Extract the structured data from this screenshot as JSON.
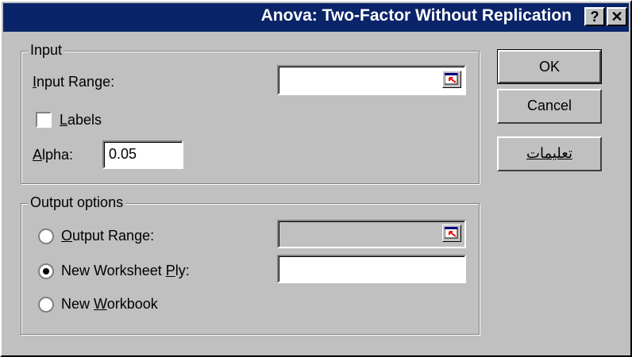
{
  "window": {
    "title": "Anova: Two-Factor Without Replication",
    "help_glyph": "?",
    "close_glyph": "✕"
  },
  "input_group": {
    "legend": "Input",
    "input_range_label_accel": "I",
    "input_range_label_rest": "nput Range:",
    "input_range_value": "",
    "labels_label_accel": "L",
    "labels_label_rest": "abels",
    "labels_checked": false,
    "alpha_label_accel": "A",
    "alpha_label_rest": "lpha:",
    "alpha_value": "0.05"
  },
  "output_group": {
    "legend": "Output options",
    "output_range_label_accel": "O",
    "output_range_label_rest": "utput Range:",
    "output_range_value": "",
    "new_worksheet_label_pre": "New Worksheet ",
    "new_worksheet_label_accel": "P",
    "new_worksheet_label_post": "ly:",
    "new_worksheet_value": "",
    "new_workbook_label_pre": "New ",
    "new_workbook_label_accel": "W",
    "new_workbook_label_post": "orkbook",
    "selected_option": "new_worksheet"
  },
  "buttons": {
    "ok": "OK",
    "cancel": "Cancel",
    "help": "تعليمات"
  },
  "colors": {
    "titlebar": "#0a246a",
    "face": "#c0c0c0",
    "ref_arrow": "#ff0000"
  },
  "icons": {
    "range_picker": "collapse-dialog-icon",
    "help": "question-mark-icon",
    "close": "close-icon"
  }
}
